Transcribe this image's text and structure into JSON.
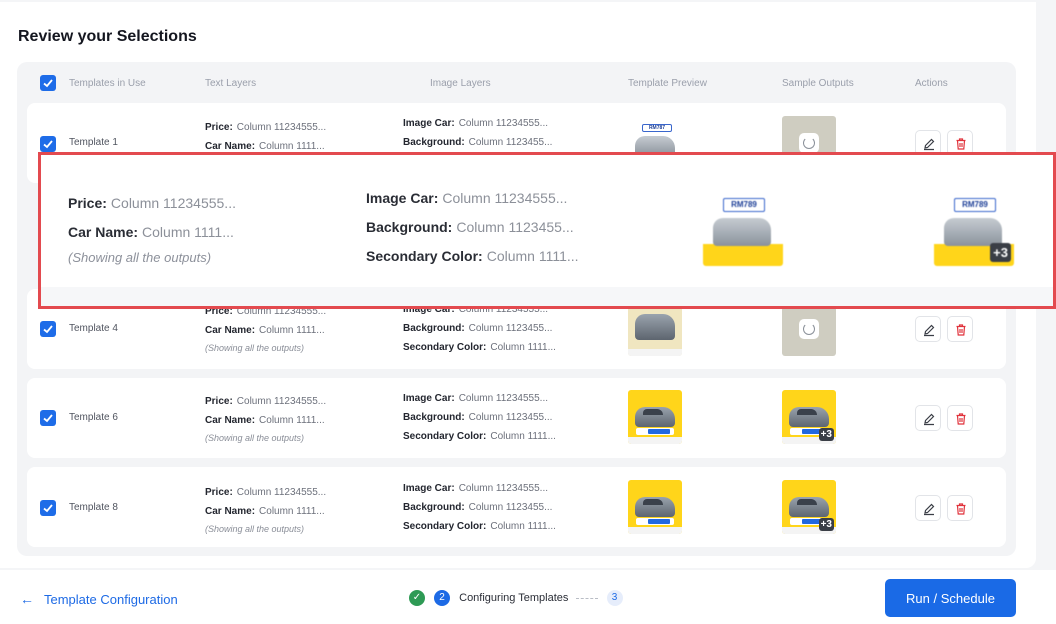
{
  "page_title": "Review your Selections",
  "table": {
    "headers": {
      "templates": "Templates in Use",
      "text_layers": "Text Layers",
      "image_layers": "Image Layers",
      "preview": "Template Preview",
      "samples": "Sample Outputs",
      "actions": "Actions"
    },
    "rows": [
      {
        "name": "Template 1",
        "checked": true,
        "text": [
          {
            "k": "Price:",
            "v": "Column 11234555..."
          },
          {
            "k": "Car Name:",
            "v": "Column 1111..."
          }
        ],
        "image": [
          {
            "k": "Image Car:",
            "v": "Column 11234555..."
          },
          {
            "k": "Background:",
            "v": "Column 1123455..."
          }
        ],
        "preview_price": "RM787",
        "sample_state": "loading"
      },
      {
        "name": "Template 4",
        "checked": true,
        "text": [
          {
            "k": "Price:",
            "v": "Column 11234555..."
          },
          {
            "k": "Car Name:",
            "v": "Column 1111..."
          }
        ],
        "note": "(Showing all the outputs)",
        "image": [
          {
            "k": "Image Car:",
            "v": "Column 11234555..."
          },
          {
            "k": "Background:",
            "v": "Column 1123455..."
          },
          {
            "k": "Secondary Color:",
            "v": "Column 1111..."
          }
        ],
        "sample_state": "loading"
      },
      {
        "name": "Template 6",
        "checked": true,
        "text": [
          {
            "k": "Price:",
            "v": "Column 11234555..."
          },
          {
            "k": "Car Name:",
            "v": "Column 1111..."
          }
        ],
        "note": "(Showing all the outputs)",
        "image": [
          {
            "k": "Image Car:",
            "v": "Column 11234555..."
          },
          {
            "k": "Background:",
            "v": "Column 1123455..."
          },
          {
            "k": "Secondary Color:",
            "v": "Column 1111..."
          }
        ],
        "sample_more": "+3"
      },
      {
        "name": "Template 8",
        "checked": true,
        "text": [
          {
            "k": "Price:",
            "v": "Column 11234555..."
          },
          {
            "k": "Car Name:",
            "v": "Column 1111..."
          }
        ],
        "note": "(Showing all the outputs)",
        "image": [
          {
            "k": "Image Car:",
            "v": "Column 11234555..."
          },
          {
            "k": "Background:",
            "v": "Column 1123455..."
          },
          {
            "k": "Secondary Color:",
            "v": "Column 1111..."
          }
        ],
        "sample_more": "+3"
      }
    ]
  },
  "zoom": {
    "text": [
      {
        "k": "Price:",
        "v": "Column 11234555..."
      },
      {
        "k": "Car Name:",
        "v": "Column 1111..."
      }
    ],
    "note": "(Showing all the outputs)",
    "image": [
      {
        "k": "Image Car:",
        "v": "Column 11234555..."
      },
      {
        "k": "Background:",
        "v": "Column 1123455..."
      },
      {
        "k": "Secondary Color:",
        "v": "Column 1111..."
      }
    ],
    "preview_price": "RM789",
    "sample_price": "RM789",
    "sample_more": "+3"
  },
  "footer": {
    "back_label": "Template Configuration",
    "step_current_num": "2",
    "step_current_label": "Configuring Templates",
    "step_next_num": "3",
    "run_label": "Run / Schedule"
  },
  "colors": {
    "accent": "#1a6ae6",
    "danger": "#e0323b",
    "success": "#2e9a55",
    "highlight_border": "#e34a4f"
  }
}
